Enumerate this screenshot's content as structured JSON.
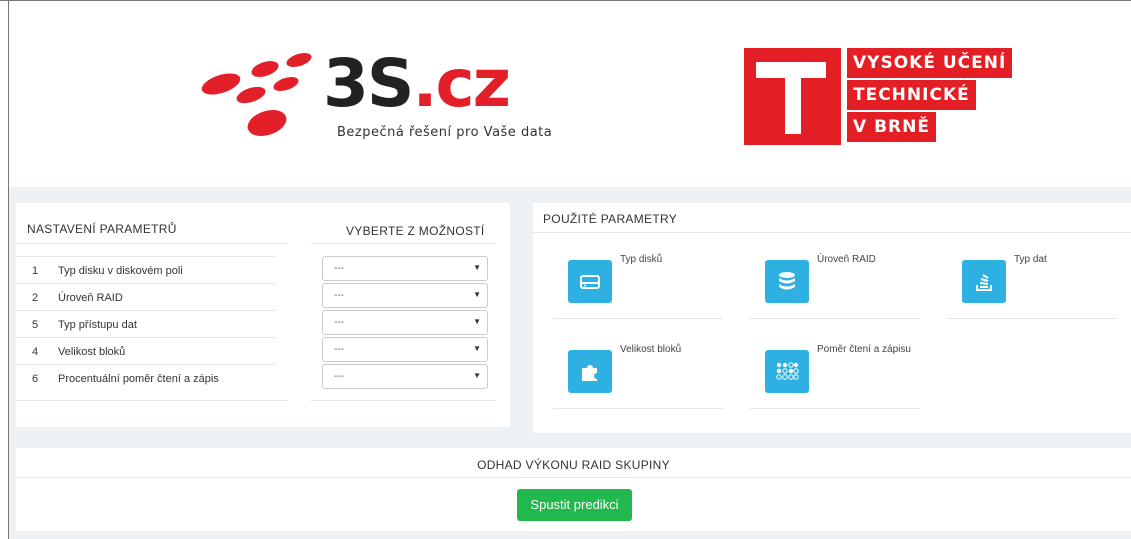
{
  "header": {
    "logo_3s": {
      "brand_main": "3S",
      "brand_suffix": ".cz",
      "tagline": "Bezpečná řešení pro Vaše data"
    },
    "logo_vut": {
      "line1": "VYSOKÉ UČENÍ",
      "line2": "TECHNICKÉ",
      "line3": "V BRNĚ"
    }
  },
  "params_panel": {
    "title": "NASTAVENÍ PARAMETRŮ",
    "choices_title": "VYBERTE Z MOŽNOSTÍ",
    "rows": [
      {
        "num": "1",
        "label": "Typ disku v diskovém poli",
        "value": "---"
      },
      {
        "num": "2",
        "label": "Úroveň RAID",
        "value": "---"
      },
      {
        "num": "5",
        "label": "Typ přístupu dat",
        "value": "---"
      },
      {
        "num": "4",
        "label": "Velikost bloků",
        "value": "---"
      },
      {
        "num": "6",
        "label": "Procentuální poměr čtení a zápis",
        "value": "---"
      }
    ]
  },
  "used_panel": {
    "title": "POUŽITÉ PARAMETRY",
    "tiles": [
      {
        "label": "Typ disků",
        "icon": "hard-drive-icon"
      },
      {
        "label": "Úroveň RAID",
        "icon": "database-icon"
      },
      {
        "label": "Typ dat",
        "icon": "stack-icon"
      },
      {
        "label": "Velikost bloků",
        "icon": "puzzle-icon"
      },
      {
        "label": "Poměr čtení a zápisu",
        "icon": "dots-grid-icon"
      }
    ]
  },
  "estimate": {
    "title": "ODHAD VÝKONU RAID SKUPINY",
    "button": "Spustit predikci"
  },
  "colors": {
    "accent_blue": "#2fb0e3",
    "button_green": "#21b84d",
    "brand_red": "#e31e24"
  }
}
